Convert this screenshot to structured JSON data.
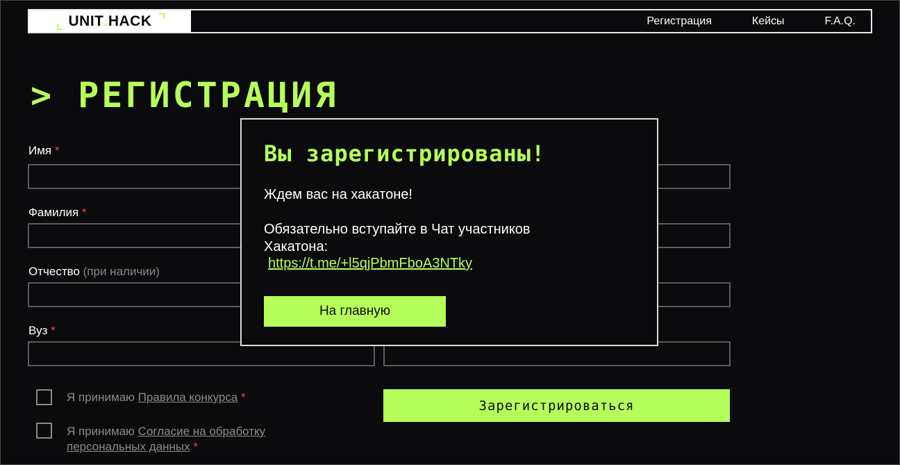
{
  "header": {
    "logo": {
      "part1": "UNIT",
      "part2": "HACK"
    },
    "nav": [
      "Регистрация",
      "Кейсы",
      "F.A.Q."
    ]
  },
  "page_title": "> РЕГИСТРАЦИЯ",
  "form": {
    "name_label": "Имя",
    "surname_label": "Фамилия",
    "patronymic_label": "Отчество",
    "patronymic_hint": "(при наличии)",
    "university_label": "Вуз",
    "required_mark": "*",
    "rules_prefix": "Я принимаю",
    "rules_link": "Правила конкурса",
    "consent_prefix": "Я принимаю",
    "consent_link_line1": "Согласие на обработку",
    "consent_link_line2": "персональных данных",
    "submit_label": "Зарегистрироваться"
  },
  "modal": {
    "title": "Вы зарегистрированы!",
    "text1": "Ждем вас на хакатоне!",
    "text2_line1": "Обязательно вступайте в Чат участников",
    "text2_line2": "Хакатона:",
    "link": "https://t.me/+l5qjPbmFboA3NTky",
    "home_button": "На главную"
  },
  "colors": {
    "accent": "#b6ff5a",
    "background": "#0b0b0d",
    "required": "#ff3b3b"
  }
}
